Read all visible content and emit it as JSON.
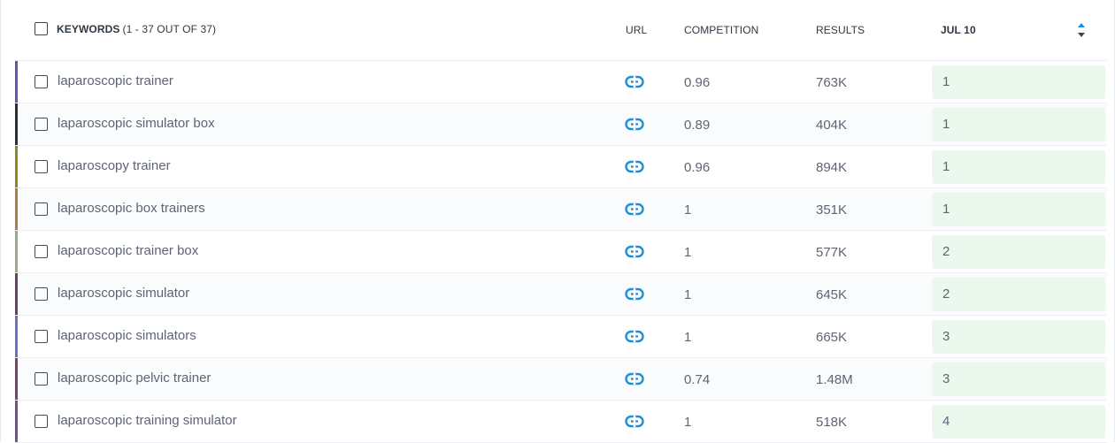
{
  "header": {
    "keywords_label": "KEYWORDS",
    "keywords_count": "(1 - 37 OUT OF 37)",
    "url_label": "URL",
    "competition_label": "COMPETITION",
    "results_label": "RESULTS",
    "date_label": "JUL 10",
    "sort_icon": "sort-up-down-icon"
  },
  "colors": {
    "link_icon": "#1d8ed9",
    "rank_bg": "#eaf8ee",
    "accents": [
      "#6a52b5",
      "#2a2f3d",
      "#8a8a1a",
      "#b07a49",
      "#9aaa82",
      "#6b3f62",
      "#6d70c0",
      "#7e3d6a",
      "#7b4d8e"
    ]
  },
  "rows": [
    {
      "keyword": "laparoscopic trainer",
      "competition": "0.96",
      "results": "763K",
      "rank": "1"
    },
    {
      "keyword": "laparoscopic simulator box",
      "competition": "0.89",
      "results": "404K",
      "rank": "1"
    },
    {
      "keyword": "laparoscopy trainer",
      "competition": "0.96",
      "results": "894K",
      "rank": "1"
    },
    {
      "keyword": "laparoscopic box trainers",
      "competition": "1",
      "results": "351K",
      "rank": "1"
    },
    {
      "keyword": "laparoscopic trainer box",
      "competition": "1",
      "results": "577K",
      "rank": "2"
    },
    {
      "keyword": "laparoscopic simulator",
      "competition": "1",
      "results": "645K",
      "rank": "2"
    },
    {
      "keyword": "laparoscopic simulators",
      "competition": "1",
      "results": "665K",
      "rank": "3"
    },
    {
      "keyword": "laparoscopic pelvic trainer",
      "competition": "0.74",
      "results": "1.48M",
      "rank": "3"
    },
    {
      "keyword": "laparoscopic training simulator",
      "competition": "1",
      "results": "518K",
      "rank": "4"
    }
  ]
}
